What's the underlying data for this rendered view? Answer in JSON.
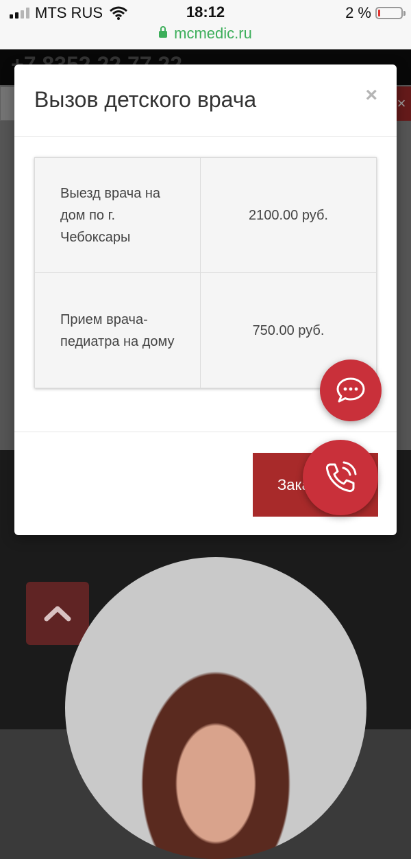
{
  "status_bar": {
    "carrier": "MTS RUS",
    "time": "18:12",
    "battery_text": "2 %",
    "battery_level_percent": 2,
    "url": "mcmedic.ru"
  },
  "background_page": {
    "phone_partial": "+7 8352 22 77 22"
  },
  "modal": {
    "title": "Вызов детского врача",
    "close_label": "×",
    "services": [
      {
        "name": "Выезд врача на дом по г. Чебоксары",
        "price": "2100.00 руб."
      },
      {
        "name": "Прием врача-педиатра на дому",
        "price": "750.00 руб."
      }
    ],
    "order_button_label": "Заказать"
  },
  "colors": {
    "accent_red": "#c9303a",
    "button_red": "#a82a2a",
    "url_green": "#3cae5a"
  },
  "icons": {
    "chat": "chat-bubble-icon",
    "call": "phone-call-icon",
    "scroll_top": "chevron-up-icon"
  }
}
